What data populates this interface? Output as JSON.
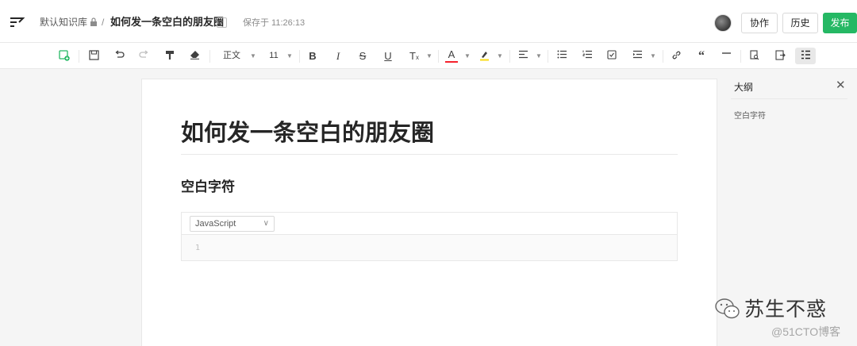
{
  "header": {
    "library": "默认知识库",
    "separator": "/",
    "doc_title": "如何发一条空白的朋友圈",
    "saved_text": "保存于 11:26:13",
    "buttons": {
      "collab": "协作",
      "history": "历史",
      "publish": "发布"
    }
  },
  "toolbar": {
    "paragraph_style": "正文",
    "font_size": "11",
    "icons": [
      "insert-icon",
      "save-icon",
      "undo-icon",
      "redo-icon",
      "format-painter-icon",
      "clear-format-icon",
      "bold-icon",
      "italic-icon",
      "strikethrough-icon",
      "underline-icon",
      "text-style-icon",
      "font-color-icon",
      "highlight-icon",
      "align-icon",
      "bullet-list-icon",
      "ordered-list-icon",
      "task-list-icon",
      "indent-icon",
      "link-icon",
      "quote-icon",
      "divider-icon",
      "search-doc-icon",
      "export-icon",
      "outline-toggle-icon"
    ]
  },
  "editor": {
    "title": "如何发一条空白的朋友圈",
    "heading": "空白字符",
    "code_language": "JavaScript",
    "line_number": "1"
  },
  "outline": {
    "title": "大纲",
    "items": [
      "空白字符"
    ]
  },
  "watermark": {
    "account": "苏生不惑",
    "site": "@51CTO博客"
  },
  "colors": {
    "accent": "#25b864",
    "border": "#e8e8e8",
    "background": "#f5f5f5"
  }
}
